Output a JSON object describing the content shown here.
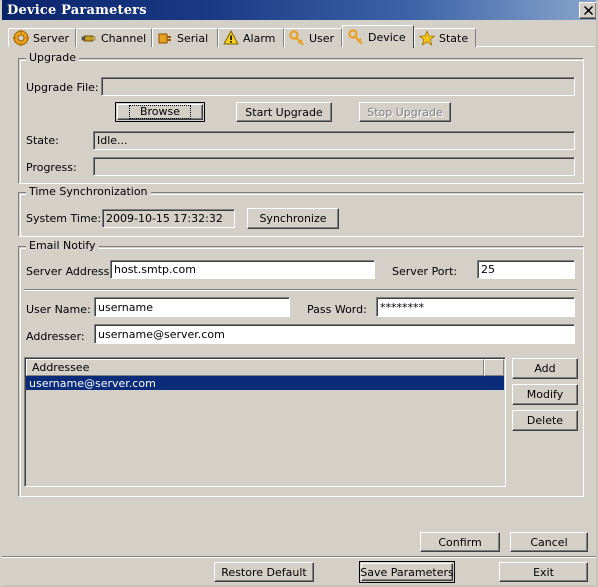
{
  "window": {
    "title": "Device Parameters",
    "close_label": "✕"
  },
  "tabs": [
    {
      "label": "Server",
      "icon": "gear-icon",
      "selected": false
    },
    {
      "label": "Channel",
      "icon": "camera-icon",
      "selected": false
    },
    {
      "label": "Serial",
      "icon": "plug-icon",
      "selected": false
    },
    {
      "label": "Alarm",
      "icon": "warning-icon",
      "selected": false
    },
    {
      "label": "User",
      "icon": "key-icon",
      "selected": false
    },
    {
      "label": "Device",
      "icon": "key-icon",
      "selected": true
    },
    {
      "label": "State",
      "icon": "star-icon",
      "selected": false
    }
  ],
  "upgrade": {
    "group_title": "Upgrade",
    "file_label": "Upgrade File:",
    "file_value": "",
    "file_placeholder": "",
    "browse_label": "Browse",
    "start_label": "Start Upgrade",
    "stop_label": "Stop Upgrade",
    "state_label": "State:",
    "state_value": "Idle...",
    "progress_label": "Progress:",
    "progress_value": ""
  },
  "time_sync": {
    "group_title": "Time Synchronization",
    "system_time_label": "System Time:",
    "system_time_value": "2009-10-15 17:32:32",
    "synchronize_label": "Synchronize"
  },
  "email": {
    "group_title": "Email Notify",
    "server_address_label": "Server Address:",
    "server_address_value": "host.smtp.com",
    "server_port_label": "Server Port:",
    "server_port_value": "25",
    "user_name_label": "User Name:",
    "user_name_value": "username",
    "password_label": "Pass Word:",
    "password_value": "********",
    "addresser_label": "Addresser:",
    "addresser_value": "username@server.com",
    "list_header": "Addressee",
    "list_rows": [
      {
        "value": "username@server.com",
        "selected": true
      }
    ],
    "add_label": "Add",
    "modify_label": "Modify",
    "delete_label": "Delete"
  },
  "footer": {
    "confirm_label": "Confirm",
    "cancel_label": "Cancel",
    "restore_default_label": "Restore Default",
    "save_parameters_label": "Save Parameters",
    "exit_label": "Exit"
  },
  "colors": {
    "face": "#d4d0c8",
    "title_start": "#0a246a",
    "title_end": "#8aa6cc",
    "selection": "#0a2a7a",
    "disabled_text": "#808080"
  }
}
